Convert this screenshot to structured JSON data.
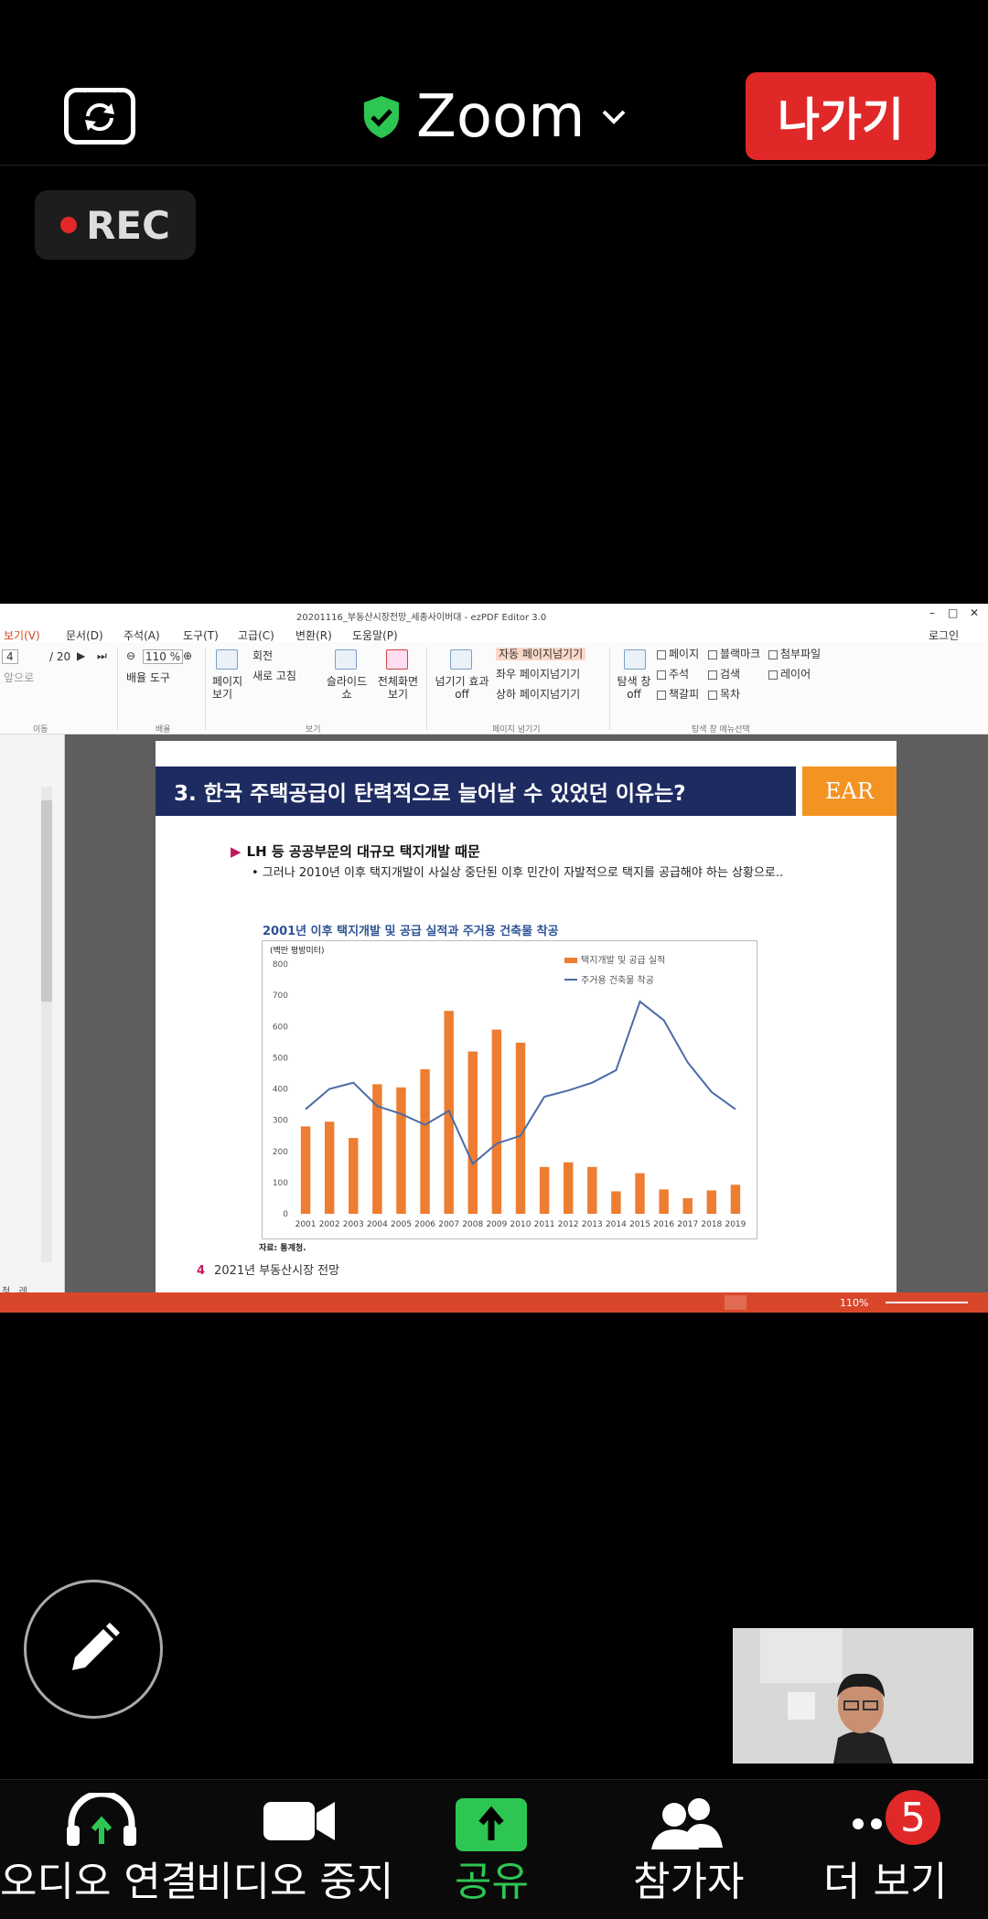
{
  "top": {
    "title": "Zoom",
    "leave_label": "나가기",
    "rec_label": "REC"
  },
  "app": {
    "window_title": "20201116_부동산시장전망_세종사이버대 - ezPDF Editor 3.0",
    "menus": [
      "보기(V)",
      "문서(D)",
      "주석(A)",
      "도구(T)",
      "고급(C)",
      "변환(R)",
      "도움말(P)"
    ],
    "login": "로그인",
    "page_input": "4",
    "page_total": "/ 20",
    "zoom_input": "110 %",
    "prev_label": "앞으로",
    "group_move": "이동",
    "group_scale": "배율",
    "group_view": "보기",
    "group_pageturn": "페이지 넘기기",
    "group_nav": "탐색 창 메뉴선택",
    "ribbon": {
      "page_view": "페이지 보기",
      "scale_tool": "배율 도구",
      "rotate": "회전",
      "refresh": "새로 고침",
      "slideshow": "슬라이드 쇼",
      "fullscreen": "전체화면 보기",
      "turn_effect": "넘기기 효과 off",
      "auto_turn": "자동 페이지넘기기",
      "lr_turn": "좌우 페이지넘기기",
      "ud_turn": "상하 페이지넘기기",
      "nav_pane": "탐색 창 off",
      "cb_page": "페이지",
      "cb_bookmark": "블랙마크",
      "cb_attach": "첨부파일",
      "cb_note": "주석",
      "cb_search": "검색",
      "cb_layer": "레이어",
      "cb_thumb": "책갈피",
      "cb_toc": "목차"
    },
    "status_zoom": "110%",
    "side_tabs": "첨.. 레.."
  },
  "slide": {
    "heading": "3. 한국 주택공급이 탄력적으로 늘어날 수 있었던 이유는?",
    "ear": "EAR",
    "bullet1": "LH 등 공공부문의 대규모 택지개발 때문",
    "bullet2": "• 그러나 2010년 이후 택지개발이 사실상 중단된 이후 민간이 자발적으로 택지를 공급해야 하는 상황으로..",
    "chart_title": "2001년 이후 택지개발 및 공급 실적과 주거용 건축물 착공",
    "source": "자료: 통계청.",
    "page_num": "4",
    "footer": "2021년 부동산시장 전망"
  },
  "chart_data": {
    "type": "bar",
    "unit_label": "(백만 평방미터)",
    "categories": [
      "2001",
      "2002",
      "2003",
      "2004",
      "2005",
      "2006",
      "2007",
      "2008",
      "2009",
      "2010",
      "2011",
      "2012",
      "2013",
      "2014",
      "2015",
      "2016",
      "2017",
      "2018",
      "2019"
    ],
    "ylim": [
      0,
      800
    ],
    "yticks": [
      0,
      100,
      200,
      300,
      400,
      500,
      600,
      700,
      800
    ],
    "series": [
      {
        "name": "택지개발 및 공급 실적",
        "kind": "bar",
        "color": "#ed7d31",
        "values": [
          280,
          295,
          243,
          415,
          405,
          463,
          650,
          520,
          590,
          548,
          150,
          165,
          150,
          72,
          130,
          78,
          50,
          75,
          93
        ]
      },
      {
        "name": "주거용 건축물 착공",
        "kind": "line",
        "color": "#4a6ca6",
        "values": [
          335,
          400,
          420,
          345,
          320,
          285,
          330,
          160,
          225,
          250,
          375,
          395,
          420,
          460,
          680,
          620,
          485,
          390,
          335
        ]
      }
    ]
  },
  "bottom": {
    "audio": "오디오 연결",
    "video": "비디오 중지",
    "share": "공유",
    "participants": "참가자",
    "more": "더 보기",
    "badge": "5"
  },
  "colors": {
    "leave": "#e02828",
    "share_green": "#2dc653",
    "shield_green": "#2dc653",
    "slide_navy": "#1d2b61",
    "slide_orange": "#f39322"
  }
}
